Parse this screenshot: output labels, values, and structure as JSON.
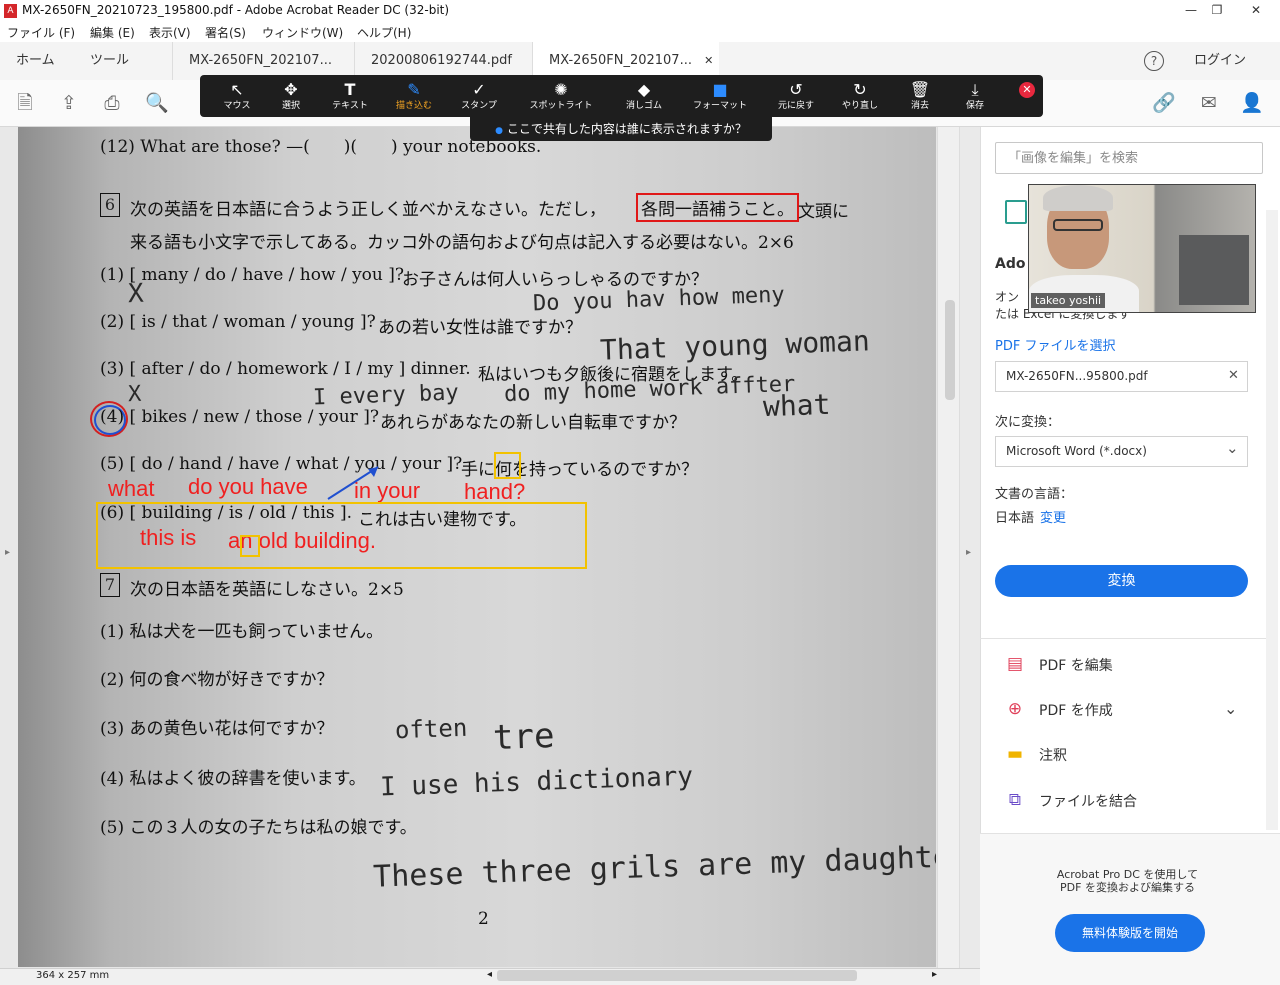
{
  "window": {
    "title": "MX-2650FN_20210723_195800.pdf - Adobe Acrobat Reader DC (32-bit)",
    "logo_glyph": "A",
    "min_glyph": "—",
    "max_glyph": "❐",
    "close_glyph": "✕"
  },
  "menu": [
    "ファイル (F)",
    "編集 (E)",
    "表示(V)",
    "署名(S)",
    "ウィンドウ(W)",
    "ヘルプ(H)"
  ],
  "tabs": {
    "home": "ホーム",
    "tools": "ツール",
    "docs": [
      "MX-2650FN_202107...",
      "20200806192744.pdf",
      "MX-2650FN_202107..."
    ],
    "close_glyph": "✕",
    "help_glyph": "?",
    "login": "ログイン"
  },
  "toolbar": {
    "icons": [
      "save-icon",
      "upload-icon",
      "print-icon",
      "zoom-icon",
      "link-icon",
      "mail-icon",
      "add-user-icon"
    ],
    "glyphs": {
      "save": "🗎",
      "upload": "⇪",
      "print": "⎙",
      "zoom": "🔍",
      "link": "🔗",
      "mail": "✉",
      "adduser": "👤"
    }
  },
  "zoom_annotate": {
    "tools": [
      {
        "label": "マウス",
        "glyph": "↖"
      },
      {
        "label": "選択",
        "glyph": "✥"
      },
      {
        "label": "テキスト",
        "glyph": "T"
      },
      {
        "label": "描き込む",
        "glyph": "✎"
      },
      {
        "label": "スタンプ",
        "glyph": "✓"
      },
      {
        "label": "スポットライト",
        "glyph": "✺"
      },
      {
        "label": "消しゴム",
        "glyph": "◆"
      },
      {
        "label": "フォーマット",
        "glyph": "■"
      },
      {
        "label": "元に戻す",
        "glyph": "↺"
      },
      {
        "label": "やり直し",
        "glyph": "↻"
      },
      {
        "label": "消去",
        "glyph": "🗑"
      },
      {
        "label": "保存",
        "glyph": "⤓"
      }
    ],
    "active_tool": "描き込む",
    "close_glyph": "✕",
    "share_notice": "ここで共有した内容は誰に表示されますか？",
    "share_icon": "●"
  },
  "worksheet": {
    "line12": "(12) What are those? —(　　)(　　) your notebooks.",
    "sec6_num": "6",
    "sec6_line1a": "次の英語を日本語に合うよう正しく並べかえなさい。ただし，",
    "sec6_boxed": "各問一語補うこと。",
    "sec6_line1b": "文頭に",
    "sec6_line2": "来る語も小文字で示してある。カッコ外の語句および句点は記入する必要はない。2×6",
    "q1": "(1) [ many / do / have / how / you ]?",
    "q1_ja": "お子さんは何人いらっしゃるのですか？",
    "q2": "(2) [ is / that / woman / young ]?",
    "q2_ja": "あの若い女性は誰ですか？",
    "q3": "(3) [ after / do / homework / I / my ] dinner.",
    "q3_ja": "私はいつも夕飯後に宿題をします。",
    "q4": "(4) [ bikes / new / those / your ]?",
    "q4_ja": "あれらがあなたの新しい自転車ですか？",
    "q5": "(5) [ do / hand / have / what / you / your ]?",
    "q5_ja": "手に何を持っているのですか？",
    "q6": "(6) [ building / is / old / this ].",
    "q6_ja": "これは古い建物です。",
    "sec7_num": "7",
    "sec7_head": "次の日本語を英語にしなさい。2×5",
    "s1": "(1) 私は犬を一匹も飼っていません。",
    "s2": "(2) 何の食べ物が好きですか？",
    "s3": "(3) あの黄色い花は何ですか？",
    "s4": "(4) 私はよく彼の辞書を使います。",
    "s5": "(5) この３人の女の子たちは私の娘です。",
    "page_no": "2",
    "handwriting": {
      "h1": "Do you hav how meny",
      "h2": "That young woman",
      "h3": "I every bay",
      "h4": "do my home work affter",
      "h5": "what",
      "h6": "X",
      "h7": "X",
      "h8": "often",
      "h9": "tre",
      "h10": "I use his dictionary",
      "h11": "These three grils are my daughters"
    },
    "red_text": {
      "r1": "what",
      "r2": "do you have",
      "r3": "in your",
      "r4": "hand?",
      "r5": "this is",
      "r6": "an old building."
    }
  },
  "status": {
    "size": "364 x 257 mm",
    "left_arrow": "◂",
    "right_arrow": "▸"
  },
  "right_panel": {
    "search_placeholder": "「画像を編集」を検索",
    "video_name": "takeo yoshii",
    "heading_partial": "Ado",
    "line_a": "オン",
    "line_b": "たは Excel に変換します",
    "pdf_select_link": "PDF ファイルを選択",
    "file_name": "MX-2650FN...95800.pdf",
    "clear_glyph": "✕",
    "convert_to_label": "次に変換：",
    "convert_to_value": "Microsoft Word (*.docx)",
    "dropdown_glyph": "⌄",
    "language_label": "文書の言語：",
    "language_value": "日本語",
    "language_change": "変更",
    "convert_button": "変換",
    "items": [
      {
        "label": "PDF を編集",
        "icon": "edit-pdf-icon",
        "glyph": "▤",
        "color": "#e0405a"
      },
      {
        "label": "PDF を作成",
        "icon": "create-pdf-icon",
        "glyph": "⊕",
        "color": "#e0405a"
      },
      {
        "label": "注釈",
        "icon": "comment-icon",
        "glyph": "▬",
        "color": "#f0b400"
      },
      {
        "label": "ファイルを結合",
        "icon": "combine-icon",
        "glyph": "⧉",
        "color": "#6a4cc8"
      }
    ],
    "expand_glyph": "⌄",
    "promo": "Acrobat Pro DC を使用して PDF を変換および編集する",
    "trial_button": "無料体験版を開始"
  }
}
